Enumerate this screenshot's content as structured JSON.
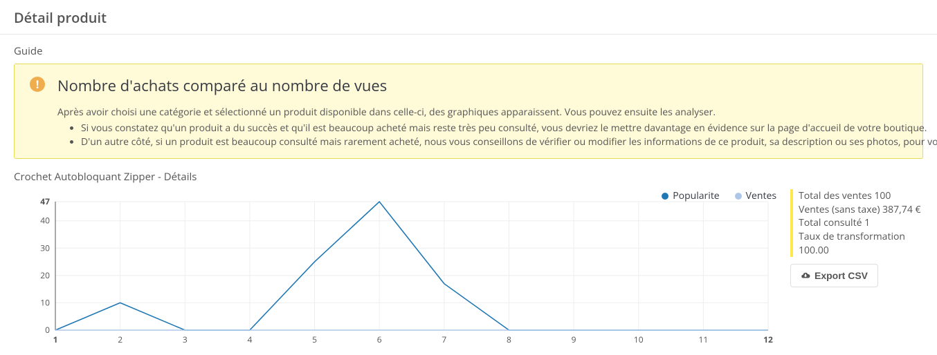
{
  "page_title": "Détail produit",
  "guide": {
    "heading": "Guide",
    "title": "Nombre d'achats comparé au nombre de vues",
    "intro": "Après avoir choisi une catégorie et sélectionné un produit disponible dans celle-ci, des graphiques apparaissent. Vous pouvez ensuite les analyser.",
    "bullets": [
      "Si vous constatez qu'un produit a du succès et qu'il est beaucoup acheté mais reste très peu consulté, vous devriez le mettre davantage en évidence sur la page d'accueil de votre boutique.",
      "D'un autre côté, si un produit est beaucoup consulté mais rarement acheté, nous vous conseillons de vérifier ou modifier les informations de ce produit, sa description ou ses photos, pour vo"
    ]
  },
  "chart_title": "Crochet Autobloquant Zipper - Détails",
  "legend": {
    "popularity": {
      "label": "Popularite",
      "color": "#1f77b4"
    },
    "sales": {
      "label": "Ventes",
      "color": "#aec7e8"
    }
  },
  "chart_data": {
    "type": "line",
    "x": [
      1,
      2,
      3,
      4,
      5,
      6,
      7,
      8,
      9,
      10,
      11,
      12
    ],
    "series": [
      {
        "name": "Popularite",
        "color": "#1f77b4",
        "values": [
          0,
          10,
          0,
          0,
          25,
          47,
          17,
          0,
          0,
          0,
          0,
          0
        ]
      },
      {
        "name": "Ventes",
        "color": "#aec7e8",
        "values": [
          0,
          0,
          0,
          0,
          0,
          0,
          0,
          0,
          0,
          0,
          0,
          0
        ]
      }
    ],
    "y_ticks": [
      0,
      10,
      20,
      30,
      40,
      47
    ],
    "ylim": [
      0,
      47
    ],
    "xlabel": "",
    "ylabel": "",
    "title": ""
  },
  "side_stats": {
    "total_sales": {
      "label": "Total des ventes",
      "value": "100"
    },
    "sales_no_tax": {
      "label": "Ventes (sans taxe)",
      "value": "387,74 €"
    },
    "total_viewed": {
      "label": "Total consulté",
      "value": "1"
    },
    "conversion": {
      "label": "Taux de transformation",
      "value": "100.00"
    }
  },
  "export_label": "Export CSV"
}
